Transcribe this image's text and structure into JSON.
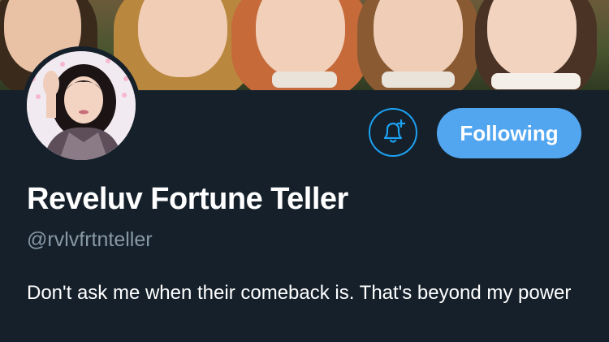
{
  "profile": {
    "display_name": "Reveluv Fortune Teller",
    "handle": "@rvlvfrtnteller",
    "bio": "Don't ask me when their comeback is. That's beyond my power"
  },
  "actions": {
    "notify_icon": "bell-plus-icon",
    "follow_label": "Following"
  },
  "colors": {
    "background": "#15202b",
    "accent": "#1da1f2",
    "following_button": "#52a6f0",
    "secondary_text": "#8899a6"
  }
}
